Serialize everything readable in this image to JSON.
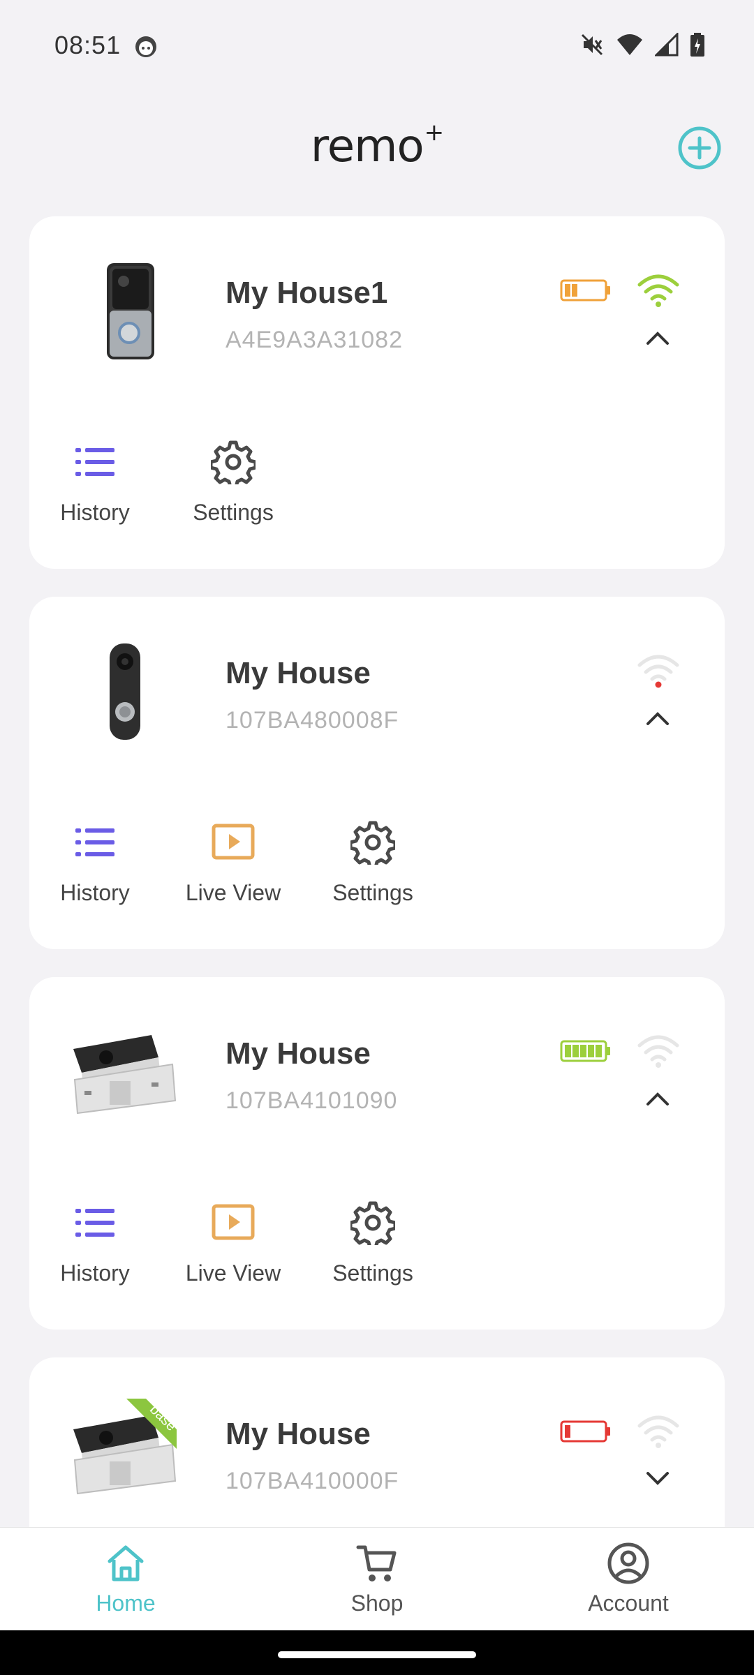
{
  "status_bar": {
    "time": "08:51"
  },
  "header": {
    "logo_text": "remo",
    "logo_superscript": "+"
  },
  "devices": [
    {
      "name": "My House1",
      "id": "A4E9A3A31082",
      "device_type": "video doorbell (silver)",
      "battery_level": 0.35,
      "battery_color": "#f0a23a",
      "wifi_state": "strong",
      "wifi_color": "#9ccf3c",
      "expanded": true,
      "actions": [
        {
          "label": "History",
          "icon": "list-icon"
        },
        {
          "label": "Settings",
          "icon": "gear-icon"
        }
      ]
    },
    {
      "name": "My House",
      "id": "107BA480008F",
      "device_type": "video doorbell (dark)",
      "wifi_state": "offline",
      "wifi_color": "#e6e6e6",
      "alert_color": "#e53935",
      "expanded": true,
      "actions": [
        {
          "label": "History",
          "icon": "list-icon"
        },
        {
          "label": "Live View",
          "icon": "play-icon"
        },
        {
          "label": "Settings",
          "icon": "gear-icon"
        }
      ]
    },
    {
      "name": "My House",
      "id": "107BA4101090",
      "device_type": "camera",
      "battery_level": 1.0,
      "battery_color": "#9ccf3c",
      "wifi_state": "weak",
      "wifi_color": "#e6e6e6",
      "expanded": true,
      "actions": [
        {
          "label": "History",
          "icon": "list-icon"
        },
        {
          "label": "Live View",
          "icon": "play-icon"
        },
        {
          "label": "Settings",
          "icon": "gear-icon"
        }
      ]
    },
    {
      "name": "My House",
      "id": "107BA410000F",
      "device_type": "camera with base",
      "badge": "base",
      "battery_level": 0.15,
      "battery_color": "#e53935",
      "wifi_state": "weak",
      "wifi_color": "#e6e6e6",
      "expanded": false,
      "actions": []
    }
  ],
  "bottom_nav": [
    {
      "label": "Home",
      "icon": "home-icon",
      "active": true
    },
    {
      "label": "Shop",
      "icon": "cart-icon",
      "active": false
    },
    {
      "label": "Account",
      "icon": "account-icon",
      "active": false
    }
  ],
  "colors": {
    "accent": "#4ec3c9",
    "history_icon": "#6a5ce6",
    "liveview_icon": "#e8aa5a",
    "settings_icon": "#4a4a4a",
    "background": "#f3f2f5"
  }
}
